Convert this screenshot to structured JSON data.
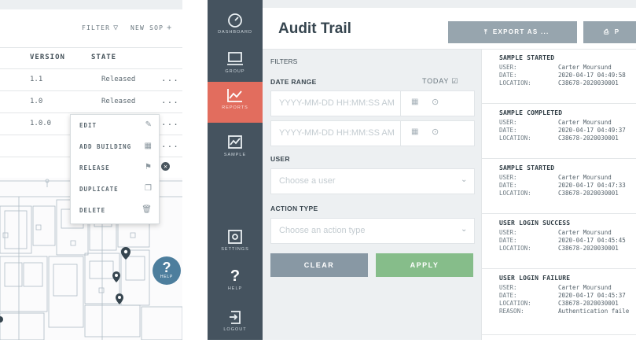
{
  "sop_list": {
    "filter_label": "FILTER",
    "new_sop_label": "NEW SOP",
    "columns": [
      "VERSION",
      "STATE"
    ],
    "rows": [
      {
        "version": "1.1",
        "state": "Released",
        "more": "..."
      },
      {
        "version": "1.0",
        "state": "Released",
        "more": "..."
      },
      {
        "version": "1.0.0",
        "state": "",
        "more": "..."
      }
    ],
    "row4_more": "...",
    "context_menu": [
      {
        "label": "EDIT",
        "icon": "pencil-icon"
      },
      {
        "label": "ADD BUILDING",
        "icon": "building-icon"
      },
      {
        "label": "RELEASE",
        "icon": "flag-icon"
      },
      {
        "label": "DUPLICATE",
        "icon": "copy-icon"
      },
      {
        "label": "DELETE",
        "icon": "trash-icon"
      }
    ],
    "help_label": "HELP"
  },
  "sidebar": {
    "items": [
      {
        "label": "DASHBOARD",
        "icon": "gauge-icon"
      },
      {
        "label": "GROUP",
        "icon": "monitor-icon"
      },
      {
        "label": "REPORTS",
        "icon": "chart-line-icon",
        "active": true
      },
      {
        "label": "SAMPLE",
        "icon": "image-chart-icon"
      },
      {
        "label": "SETTINGS",
        "icon": "settings-icon"
      },
      {
        "label": "HELP",
        "icon": "question-icon"
      },
      {
        "label": "LOGOUT",
        "icon": "logout-icon"
      }
    ],
    "active_color": "#e26d5e",
    "bg_color": "#45535f"
  },
  "header": {
    "title": "Audit Trail",
    "export_label": "EXPORT AS ...",
    "print_label": "P"
  },
  "filters": {
    "heading": "FILTERS",
    "date_range_label": "DATE RANGE",
    "today_label": "TODAY",
    "date_placeholder": "YYYY-MM-DD HH:MM:SS AM",
    "user_label": "USER",
    "user_placeholder": "Choose a user",
    "action_label": "ACTION TYPE",
    "action_placeholder": "Choose an action type",
    "clear_label": "CLEAR",
    "apply_label": "APPLY"
  },
  "events": [
    {
      "title": "SAMPLE STARTED",
      "fields": [
        [
          "USER:",
          "Carter Moursund"
        ],
        [
          "DATE:",
          "2020-04-17 04:49:58"
        ],
        [
          "LOCATION:",
          "C38678-2020030001"
        ]
      ]
    },
    {
      "title": "SAMPLE COMPLETED",
      "fields": [
        [
          "USER:",
          "Carter Moursund"
        ],
        [
          "DATE:",
          "2020-04-17 04:49:37"
        ],
        [
          "LOCATION:",
          "C38678-2020030001"
        ]
      ]
    },
    {
      "title": "SAMPLE STARTED",
      "fields": [
        [
          "USER:",
          "Carter Moursund"
        ],
        [
          "DATE:",
          "2020-04-17 04:47:33"
        ],
        [
          "LOCATION:",
          "C38678-2020030001"
        ]
      ]
    },
    {
      "title": "USER LOGIN SUCCESS",
      "fields": [
        [
          "USER:",
          "Carter Moursund"
        ],
        [
          "DATE:",
          "2020-04-17 04:45:45"
        ],
        [
          "LOCATION:",
          "C38678-2020030001"
        ]
      ]
    },
    {
      "title": "USER LOGIN FAILURE",
      "fields": [
        [
          "USER:",
          "Carter Moursund"
        ],
        [
          "DATE:",
          "2020-04-17 04:45:37"
        ],
        [
          "LOCATION:",
          "C38678-2020030001"
        ],
        [
          "REASON:",
          "Authentication faile"
        ]
      ]
    }
  ]
}
